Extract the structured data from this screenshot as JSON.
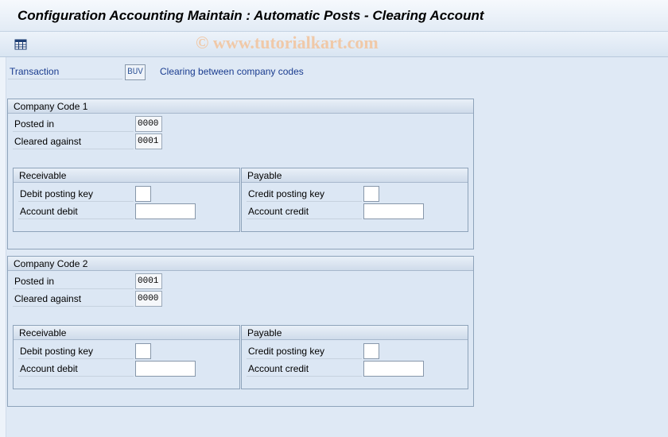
{
  "window": {
    "title": "Configuration Accounting Maintain : Automatic Posts - Clearing Account",
    "watermark": "© www.tutorialkart.com"
  },
  "toolbar": {
    "icons": [
      "table-settings-icon"
    ]
  },
  "header": {
    "transaction_label": "Transaction",
    "transaction_value": "BUV",
    "transaction_description": "Clearing between company codes"
  },
  "company_code_1": {
    "title": "Company Code 1",
    "posted_in_label": "Posted in",
    "posted_in_value": "0000",
    "cleared_against_label": "Cleared against",
    "cleared_against_value": "0001",
    "receivable": {
      "title": "Receivable",
      "debit_posting_key_label": "Debit posting key",
      "debit_posting_key_value": "",
      "account_debit_label": "Account debit",
      "account_debit_value": ""
    },
    "payable": {
      "title": "Payable",
      "credit_posting_key_label": "Credit posting key",
      "credit_posting_key_value": "",
      "account_credit_label": "Account credit",
      "account_credit_value": ""
    }
  },
  "company_code_2": {
    "title": "Company Code 2",
    "posted_in_label": "Posted in",
    "posted_in_value": "0001",
    "cleared_against_label": "Cleared against",
    "cleared_against_value": "0000",
    "receivable": {
      "title": "Receivable",
      "debit_posting_key_label": "Debit posting key",
      "debit_posting_key_value": "",
      "account_debit_label": "Account debit",
      "account_debit_value": ""
    },
    "payable": {
      "title": "Payable",
      "credit_posting_key_label": "Credit posting key",
      "credit_posting_key_value": "",
      "account_credit_label": "Account credit",
      "account_credit_value": ""
    }
  }
}
